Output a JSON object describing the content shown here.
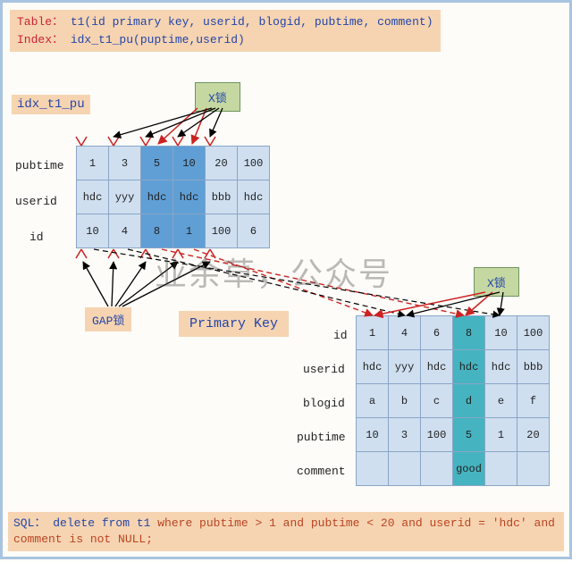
{
  "header": {
    "table_label": "Table：",
    "table_def": "t1(id primary key, userid, blogid, pubtime, comment)",
    "index_label": "Index：",
    "index_def": "idx_t1_pu(puptime,userid)"
  },
  "index_name": "idx_t1_pu",
  "xlock_label": "X锁",
  "gap_label": "GAP锁",
  "pk_label": "Primary Key",
  "watermark": "业余草，公众号",
  "index_table": {
    "row_labels": [
      "pubtime",
      "userid",
      "id"
    ],
    "cols": [
      [
        "1",
        "hdc",
        "10"
      ],
      [
        "3",
        "yyy",
        "4"
      ],
      [
        "5",
        "hdc",
        "8"
      ],
      [
        "10",
        "hdc",
        "1"
      ],
      [
        "20",
        "bbb",
        "100"
      ],
      [
        "100",
        "hdc",
        "6"
      ]
    ],
    "highlight_cols": [
      2,
      3
    ]
  },
  "pk_table": {
    "row_labels": [
      "id",
      "userid",
      "blogid",
      "pubtime",
      "comment"
    ],
    "cols": [
      [
        "1",
        "hdc",
        "a",
        "10",
        ""
      ],
      [
        "4",
        "yyy",
        "b",
        "3",
        ""
      ],
      [
        "6",
        "hdc",
        "c",
        "100",
        ""
      ],
      [
        "8",
        "hdc",
        "d",
        "5",
        "good"
      ],
      [
        "10",
        "hdc",
        "e",
        "1",
        ""
      ],
      [
        "100",
        "bbb",
        "f",
        "20",
        ""
      ]
    ],
    "highlight_cols": [
      3
    ]
  },
  "sql": {
    "prefix": "SQL：",
    "stmt": "delete from t1 ",
    "where": "where pubtime > 1 and pubtime < 20 and userid = 'hdc' and comment is not NULL;"
  }
}
